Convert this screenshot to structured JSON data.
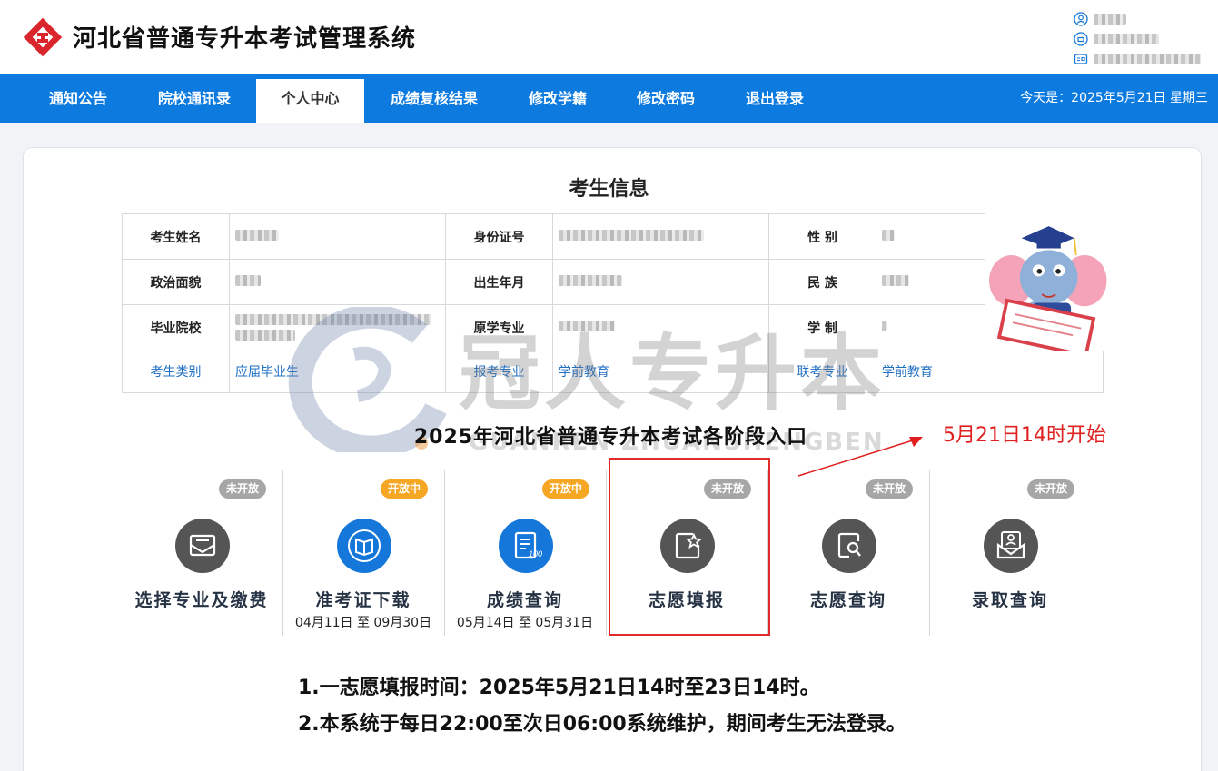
{
  "header": {
    "title": "河北省普通专升本考试管理系统"
  },
  "nav": {
    "items": [
      {
        "label": "通知公告"
      },
      {
        "label": "院校通讯录"
      },
      {
        "label": "个人中心"
      },
      {
        "label": "成绩复核结果"
      },
      {
        "label": "修改学籍"
      },
      {
        "label": "修改密码"
      },
      {
        "label": "退出登录"
      }
    ],
    "active_index": 2,
    "date": "今天是：2025年5月21日 星期三"
  },
  "info": {
    "title": "考生信息",
    "labels": {
      "name": "考生姓名",
      "id": "身份证号",
      "gender": "性 别",
      "political": "政治面貌",
      "birth": "出生年月",
      "ethnicity": "民 族",
      "school": "毕业院校",
      "major": "原学专业",
      "duration": "学 制",
      "category": "考生类别",
      "apply_major": "报考专业",
      "joint_major": "联考专业"
    },
    "values": {
      "category": "应届毕业生",
      "apply_major": "学前教育",
      "joint_major": "学前教育"
    }
  },
  "watermark": {
    "text": "冠人专升本",
    "sub": "GUANREN ZHUANSHENGBEN"
  },
  "stages": {
    "title": "2025年河北省普通专升本考试各阶段入口",
    "annotation": "5月21日14时开始",
    "items": [
      {
        "name": "选择专业及缴费",
        "status": "未开放",
        "dates": "",
        "icon": "envelope-icon"
      },
      {
        "name": "准考证下载",
        "status": "开放中",
        "dates": "04月11日 至 09月30日",
        "icon": "book-icon"
      },
      {
        "name": "成绩查询",
        "status": "开放中",
        "dates": "05月14日 至 05月31日",
        "icon": "score-document-icon"
      },
      {
        "name": "志愿填报",
        "status": "未开放",
        "dates": "",
        "icon": "star-document-icon"
      },
      {
        "name": "志愿查询",
        "status": "未开放",
        "dates": "",
        "icon": "search-document-icon"
      },
      {
        "name": "录取查询",
        "status": "未开放",
        "dates": "",
        "icon": "user-envelope-icon"
      }
    ]
  },
  "notes": {
    "line1": "1.一志愿填报时间：2025年5月21日14时至23日14时。",
    "line2": "2.本系统于每日22:00至次日06:00系统维护，期间考生无法登录。"
  },
  "colors": {
    "nav_bg": "#0c7adf",
    "badge_open": "#f5a623",
    "badge_closed": "#a6a6a6",
    "highlight": "#e12a2a",
    "label_blue": "#1f6fc5"
  }
}
